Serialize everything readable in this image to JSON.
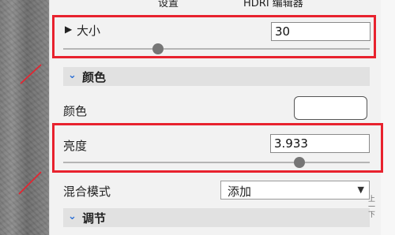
{
  "tabs": [
    "设置",
    "HDRI 编辑器"
  ],
  "size_row": {
    "label": "大小",
    "toggle_icon": "triangle-right-icon",
    "value": "30",
    "slider_fraction": 0.36
  },
  "color_section": {
    "title": "颜色",
    "icon": "chevron-down-icon"
  },
  "color_row": {
    "label": "颜色",
    "swatch": "#ffffff"
  },
  "brightness_row": {
    "label": "亮度",
    "value": "3.933",
    "slider_fraction": 0.78
  },
  "blend_row": {
    "label": "混合模式",
    "selected": "添加",
    "icon": "chevron-down-icon"
  },
  "adjust_section": {
    "title": "调节",
    "icon": "chevron-down-icon"
  },
  "side_text": "上\n一\n下",
  "highlight_color": "#e8222e"
}
